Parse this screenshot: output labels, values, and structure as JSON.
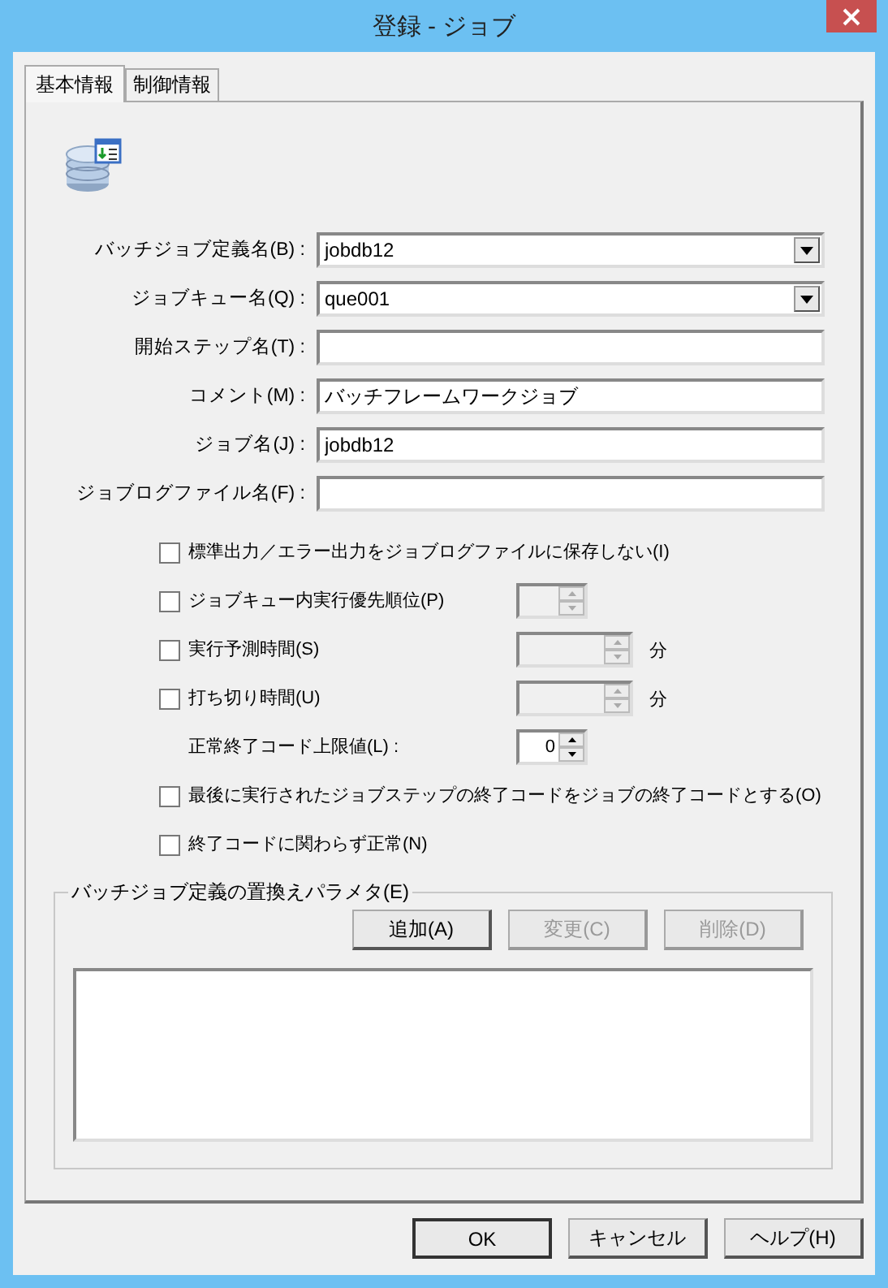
{
  "window": {
    "title": "登録 - ジョブ"
  },
  "tabs": [
    {
      "label": "基本情報",
      "selected": true
    },
    {
      "label": "制御情報",
      "selected": false
    }
  ],
  "fields": [
    {
      "kind": "combo",
      "label": "バッチジョブ定義名(B) :",
      "value": "jobdb12"
    },
    {
      "kind": "combo",
      "label": "ジョブキュー名(Q) :",
      "value": "que001"
    },
    {
      "kind": "text",
      "label": "開始ステップ名(T) :"
    },
    {
      "kind": "text",
      "label": "コメント(M) :",
      "value": "バッチフレームワークジョブ"
    },
    {
      "kind": "text",
      "label": "ジョブ名(J) :",
      "value": "jobdb12"
    },
    {
      "kind": "text",
      "label": "ジョブログファイル名(F) :"
    }
  ],
  "options": [
    {
      "kind": "checkbox",
      "label": "標準出力／エラー出力をジョブログファイルに保存しない(I)",
      "checked": false
    },
    {
      "kind": "checkbox-spin",
      "label": "ジョブキュー内実行優先順位(P)",
      "checked": false,
      "spin": {
        "disabled": true,
        "wide": false
      }
    },
    {
      "kind": "checkbox-spin",
      "label": "実行予測時間(S)",
      "checked": false,
      "spin": {
        "disabled": true,
        "wide": true,
        "unit": "分"
      }
    },
    {
      "kind": "checkbox-spin",
      "label": "打ち切り時間(U)",
      "checked": false,
      "spin": {
        "disabled": true,
        "wide": true,
        "unit": "分"
      }
    },
    {
      "kind": "label-spin",
      "label": "正常終了コード上限値(L) :",
      "spin": {
        "disabled": false,
        "wide": false,
        "value": "0"
      }
    },
    {
      "kind": "checkbox",
      "label": "最後に実行されたジョブステップの終了コードをジョブの終了コードとする(O)",
      "checked": false
    },
    {
      "kind": "checkbox",
      "label": "終了コードに関わらず正常(N)",
      "checked": false
    }
  ],
  "group": {
    "legend": "バッチジョブ定義の置換えパラメタ(E)",
    "buttons": [
      {
        "label": "追加(A)",
        "disabled": false
      },
      {
        "label": "変更(C)",
        "disabled": true
      },
      {
        "label": "削除(D)",
        "disabled": true
      }
    ]
  },
  "footer_buttons": [
    {
      "label": "OK",
      "default": true
    },
    {
      "label": "キャンセル",
      "default": false
    },
    {
      "label": "ヘルプ(H)",
      "default": false
    }
  ]
}
